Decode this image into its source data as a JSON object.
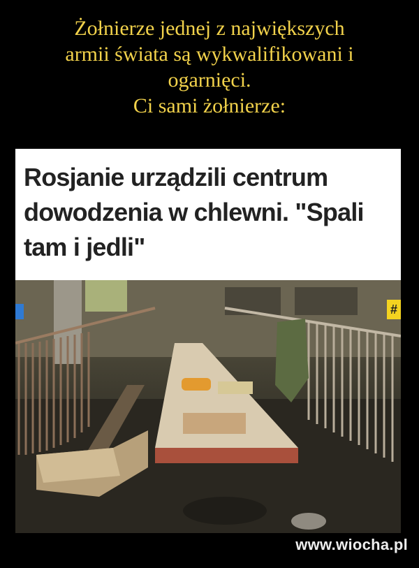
{
  "caption": {
    "line1": "Żołnierze jednej z największych",
    "line2": "armii świata są wykwalifikowani i",
    "line3": "ogarnięci.",
    "line4": "Ci sami żołnierze:"
  },
  "article": {
    "headline": "Rosjanie urządzili centrum dowodzenia w chlewni. \"Spali tam i jedli\"",
    "badge": "#"
  },
  "watermark": "www.wiocha.pl",
  "colors": {
    "caption_text": "#f2d24b",
    "background": "#000000",
    "badge": "#f4d320"
  }
}
